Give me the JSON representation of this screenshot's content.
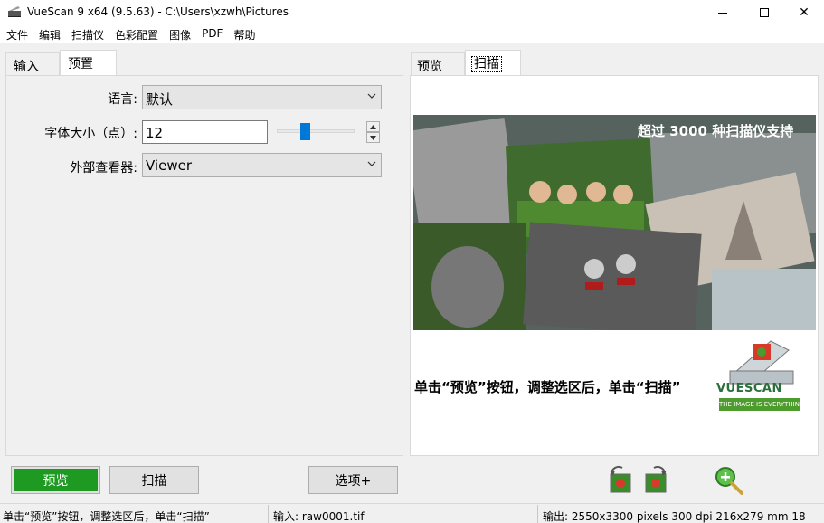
{
  "window": {
    "title": "VueScan 9 x64 (9.5.63) - C:\\Users\\xzwh\\Pictures",
    "minimize": "",
    "maximize": "",
    "close": "✕"
  },
  "menu": [
    "文件",
    "编辑",
    "扫描仪",
    "色彩配置",
    "图像",
    "PDF",
    "帮助"
  ],
  "left_tabs": {
    "input": "输入",
    "prefs": "预置"
  },
  "prefs": {
    "language_label": "语言:",
    "language_value": "默认",
    "font_size_label": "字体大小（点）:",
    "font_size_value": "12",
    "viewer_label": "外部查看器:",
    "viewer_value": "Viewer"
  },
  "right_tabs": {
    "preview": "预览",
    "scan": "扫描"
  },
  "banner": {
    "caption": "超过 3000 种扫描仪支持",
    "instruction": "单击“预览”按钮，调整选区后，单击“扫描”",
    "logo_title": "VUESCAN",
    "logo_tagline": "THE IMAGE IS EVERYTHING"
  },
  "buttons": {
    "preview": "预览",
    "scan": "扫描",
    "options": "选项+"
  },
  "icons": [
    "rotate-left-icon",
    "rotate-right-icon",
    "zoom-in-icon"
  ],
  "status": {
    "hint": "单击“预览”按钮，调整选区后，单击“扫描”",
    "input": "输入: raw0001.tif",
    "output": "输出: 2550x3300 pixels 300 dpi 216x279 mm 18...."
  },
  "colors": {
    "preview_button": "#1e9a22",
    "slider_thumb": "#0078d7"
  }
}
